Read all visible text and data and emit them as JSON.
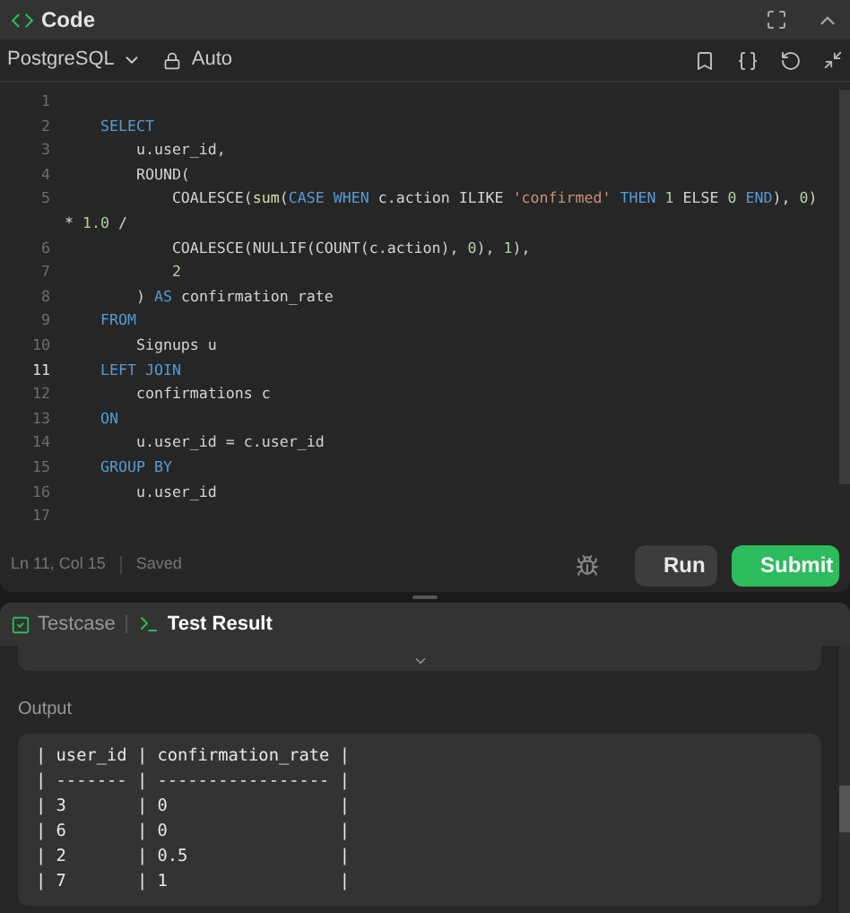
{
  "panel": {
    "title": "Code"
  },
  "toolbar": {
    "language": "PostgreSQL",
    "mode": "Auto"
  },
  "code_lines": [
    {
      "number": "1"
    },
    {
      "number": "2",
      "tokens": [
        {
          "text": "    SELECT",
          "kind": "keyword"
        }
      ]
    },
    {
      "number": "3",
      "tokens": [
        {
          "text": "        u.user_id,",
          "kind": "plain"
        }
      ]
    },
    {
      "number": "4",
      "tokens": [
        {
          "text": "        ROUND(",
          "kind": "plain"
        }
      ]
    },
    {
      "number": "5",
      "tokens": [
        {
          "text": "            COALESCE(",
          "kind": "plain"
        },
        {
          "text": "sum",
          "kind": "function"
        },
        {
          "text": "(",
          "kind": "plain"
        },
        {
          "text": "CASE WHEN",
          "kind": "keyword"
        },
        {
          "text": " c.action ILIKE ",
          "kind": "plain"
        },
        {
          "text": "'confirmed' ",
          "kind": "string"
        },
        {
          "text": "THEN ",
          "kind": "keyword"
        },
        {
          "text": "1",
          "kind": "number"
        },
        {
          "text": " ELSE ",
          "kind": "plain"
        },
        {
          "text": "0 ",
          "kind": "number"
        },
        {
          "text": "END",
          "kind": "keyword"
        },
        {
          "text": "), ",
          "kind": "plain"
        },
        {
          "text": "0",
          "kind": "number"
        },
        {
          "text": ")",
          "kind": "plain"
        }
      ]
    },
    {
      "tokens": [
        {
          "text": "* ",
          "kind": "plain"
        },
        {
          "text": "1.0",
          "kind": "number"
        },
        {
          "text": " /",
          "kind": "plain"
        }
      ]
    },
    {
      "number": "6",
      "tokens": [
        {
          "text": "            COALESCE(NULLIF(COUNT(c.action), ",
          "kind": "plain"
        },
        {
          "text": "0",
          "kind": "number"
        },
        {
          "text": "), ",
          "kind": "plain"
        },
        {
          "text": "1",
          "kind": "number"
        },
        {
          "text": "),",
          "kind": "plain"
        }
      ]
    },
    {
      "number": "7",
      "tokens": [
        {
          "text": "            2",
          "kind": "number"
        }
      ]
    },
    {
      "number": "8",
      "tokens": [
        {
          "text": "        ) ",
          "kind": "plain"
        },
        {
          "text": "AS",
          "kind": "keyword"
        },
        {
          "text": " confirmation_rate",
          "kind": "plain"
        }
      ]
    },
    {
      "number": "9",
      "tokens": [
        {
          "text": "    FROM",
          "kind": "keyword"
        }
      ]
    },
    {
      "number": "10",
      "tokens": [
        {
          "text": "        Signups u",
          "kind": "plain"
        }
      ]
    },
    {
      "number": "11",
      "current": true,
      "tokens": [
        {
          "text": "    LEFT JOIN",
          "kind": "keyword"
        }
      ]
    },
    {
      "number": "12",
      "tokens": [
        {
          "text": "        confirmations c",
          "kind": "plain"
        }
      ]
    },
    {
      "number": "13",
      "tokens": [
        {
          "text": "    ON",
          "kind": "keyword"
        }
      ]
    },
    {
      "number": "14",
      "tokens": [
        {
          "text": "        u.user_id = c.user_id",
          "kind": "plain"
        }
      ]
    },
    {
      "number": "15",
      "tokens": [
        {
          "text": "    GROUP BY",
          "kind": "keyword"
        }
      ]
    },
    {
      "number": "16",
      "tokens": [
        {
          "text": "        u.user_id",
          "kind": "plain"
        }
      ]
    },
    {
      "number": "17"
    }
  ],
  "status_bar": {
    "position": "Ln 11, Col 15",
    "state": "Saved"
  },
  "buttons": [
    {
      "label": "Run",
      "kind": "secondary"
    },
    {
      "label": "Submit",
      "kind": "primary"
    }
  ],
  "result_tabs": [
    {
      "label": "Testcase",
      "selected": false
    },
    {
      "label": "Test Result",
      "selected": true
    }
  ],
  "output": {
    "label": "Output",
    "lines": [
      "| user_id | confirmation_rate |",
      "| ------- | ----------------- |",
      "| 3       | 0                 |",
      "| 6       | 0                 |",
      "| 2       | 0.5               |",
      "| 7       | 1                 |"
    ]
  }
}
